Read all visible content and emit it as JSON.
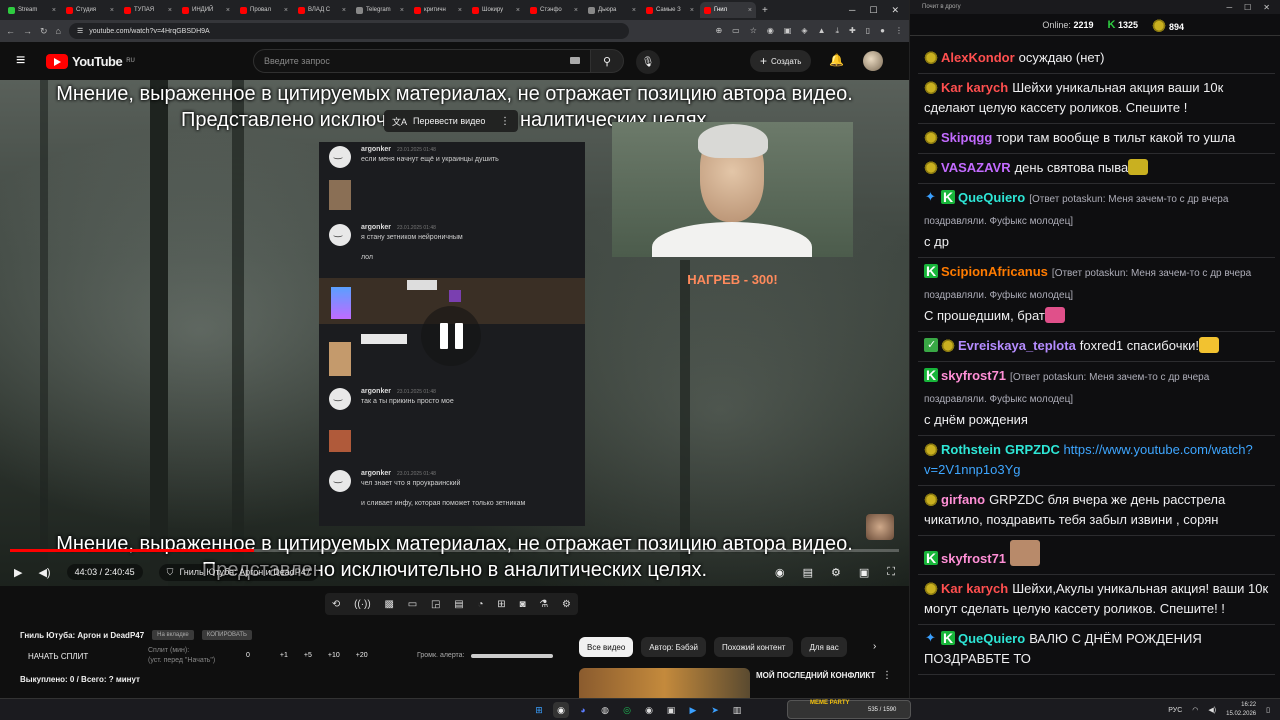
{
  "browser": {
    "tabs": [
      "Stream",
      "Студия",
      "ТУПАЯ",
      "ИНДИЙ",
      "Провал",
      "ВЛАД С",
      "Telegram",
      "критичн",
      "Шокиру",
      "Стэнфо",
      "Дьюра",
      "Самые З",
      "Гнил"
    ],
    "active_tab": 12,
    "url": "youtube.com/watch?v=4HrqGBSDH9A",
    "tab_colors": [
      "#2ecc40",
      "#ff0000",
      "#ff0000",
      "#ff0000",
      "#ff0000",
      "#ff0000",
      "#888888",
      "#ff0000",
      "#ff0000",
      "#ff0000",
      "#888888",
      "#ff0000",
      "#ff0000"
    ]
  },
  "youtube": {
    "logo_text": "YouTube",
    "logo_region": "RU",
    "search_placeholder": "Введите запрос",
    "create_label": "Создать"
  },
  "video": {
    "caption_top_line1": "Мнение, выраженное в цитируемых материалах, не отражает позицию автора видео.",
    "caption_top_line2": "Представлено исключ",
    "caption_top_line2_tail": "налитических целях.",
    "translate_label": "Перевести видео",
    "caption_bottom_line1": "Мнение, выраженное в цитируемых материалах, не отражает позицию автора видео.",
    "caption_bottom_line2": "Представлено исключительно в аналитических целях.",
    "heat_label": "НАГРЕВ - 300!",
    "time_current": "44:03",
    "time_total": "2:40:45",
    "progress_fraction": 0.275,
    "chapter_label": "Гниль Ютуба: Аргон и DeadP47",
    "discord": [
      {
        "name": "argonker",
        "date": "23.01.2025 01:48",
        "lines": [
          "если меня начнут ещё и украинцы душить"
        ]
      },
      {
        "name": "argonker",
        "date": "23.01.2025 01:48",
        "lines": [
          "я стану зетником нейроничным",
          "лол"
        ]
      },
      {
        "name": "argonker",
        "date": "23.01.2025 01:48",
        "lines": [
          "так а ты прикинь просто мое"
        ]
      },
      {
        "name": "argonker",
        "date": "23.01.2025 01:48",
        "lines": [
          "чел знает что я проукраинский",
          "и сливает инфу, которая поможет только зетникам"
        ]
      }
    ]
  },
  "below": {
    "extension_title": "Гниль Ютуба: Аргон и DeadP47",
    "ext_badge1": "На вкладке",
    "ext_badge2": "КОПИРОВАТЬ",
    "start_split": "НАЧАТЬ СПЛИТ",
    "split_sub1": "Сплит (мин):",
    "split_sub2": "(уст. перед \"Начать\")",
    "split_nums": [
      "0",
      "+1",
      "+5",
      "+10",
      "+20"
    ],
    "alert_label": "Громк. алерта:",
    "paid_footer": "Выкуплено: 0 / Всего: ? минут",
    "chips": [
      "Все видео",
      "Автор: Бэбэй",
      "Похожий контент",
      "Для вас"
    ],
    "reco_title": "МОЙ ПОСЛЕДНИЙ КОНФЛИКТ"
  },
  "chat": {
    "window_title": "Почит в дрогу",
    "online_label": "Online:",
    "online_count": "2219",
    "k_count": "1325",
    "pepe_count": "894",
    "messages": [
      {
        "user": "AlexKondor",
        "color": "#ff4f4f",
        "badges": [
          "pepe"
        ],
        "reply": "",
        "text": "осуждаю (нет)"
      },
      {
        "user": "Kar karych",
        "color": "#ff4f4f",
        "badges": [
          "pepe"
        ],
        "reply": "",
        "text": "Шейхи уникальная акция ваши 10к сделают целую кассету роликов. Спешите !"
      },
      {
        "user": "Skipqgg",
        "color": "#c36bff",
        "badges": [
          "pepe"
        ],
        "reply": "",
        "text": "тори там вообще в тильт какой то ушла"
      },
      {
        "user": "VASAZAVR",
        "color": "#c36bff",
        "badges": [
          "pepe"
        ],
        "reply": "",
        "text": "день святова пыва"
      },
      {
        "user": "QueQuiero",
        "color": "#2ee6d6",
        "badges": [
          "sword",
          "k"
        ],
        "reply": "[Ответ potaskun: Меня зачем-то с др вчера поздравляли. Фуфыкс молодец]",
        "text": "с др"
      },
      {
        "user": "ScipionAfricanus",
        "color": "#ff7b00",
        "badges": [
          "k"
        ],
        "reply": "[Ответ potaskun: Меня зачем-то с др вчера поздравляли. Фуфыкс молодец]",
        "text": "С прошедшим, брат"
      },
      {
        "user": "Evreiskaya_teplota",
        "color": "#b58cff",
        "badges": [
          "check",
          "pepe"
        ],
        "reply": "",
        "text": "foxred1 спасибочки!"
      },
      {
        "user": "skyfrost71",
        "color": "#ff8fd6",
        "badges": [
          "k"
        ],
        "reply": "[Ответ potaskun: Меня зачем-то с др вчера поздравляли. Фуфыкс молодец]",
        "text": "с днём рождения"
      },
      {
        "user": "Rothstein",
        "color": "#2ee6d6",
        "badges": [
          "pepe"
        ],
        "reply": "",
        "text": "GRPZDC https://www.youtube.com/watch?v=2V1nnp1o3Yg"
      },
      {
        "user": "girfano",
        "color": "#ff8fd6",
        "badges": [
          "pepe"
        ],
        "reply": "",
        "text": "GRPZDC бля вчера же день расстрела чикатило, поздравить тебя забыл извини , сорян"
      },
      {
        "user": "skyfrost71",
        "color": "#ff8fd6",
        "badges": [
          "k"
        ],
        "reply": "",
        "text": ""
      },
      {
        "user": "Kar karych",
        "color": "#ff4f4f",
        "badges": [
          "pepe"
        ],
        "reply": "",
        "text": "Шейхи,Акулы уникальная акция! ваши 10к могут сделать целую кассету роликов. Спешите! !"
      },
      {
        "user": "QueQuiero",
        "color": "#2ee6d6",
        "badges": [
          "sword",
          "k"
        ],
        "reply": "",
        "text": "ВАЛЮ С ДНЁМ РОЖДЕНИЯ ПОЗДРАВБТЕ ТО"
      }
    ]
  },
  "taskbar": {
    "meme_label": "MEME PARTY",
    "meme_count": "535 / 1590",
    "lang": "РУС",
    "time": "16:22",
    "date": "15.02.2026"
  },
  "colors": {
    "yt_red": "#ff0000",
    "twitch_green": "#18b53a",
    "heat_orange": "#ff8a5c"
  }
}
